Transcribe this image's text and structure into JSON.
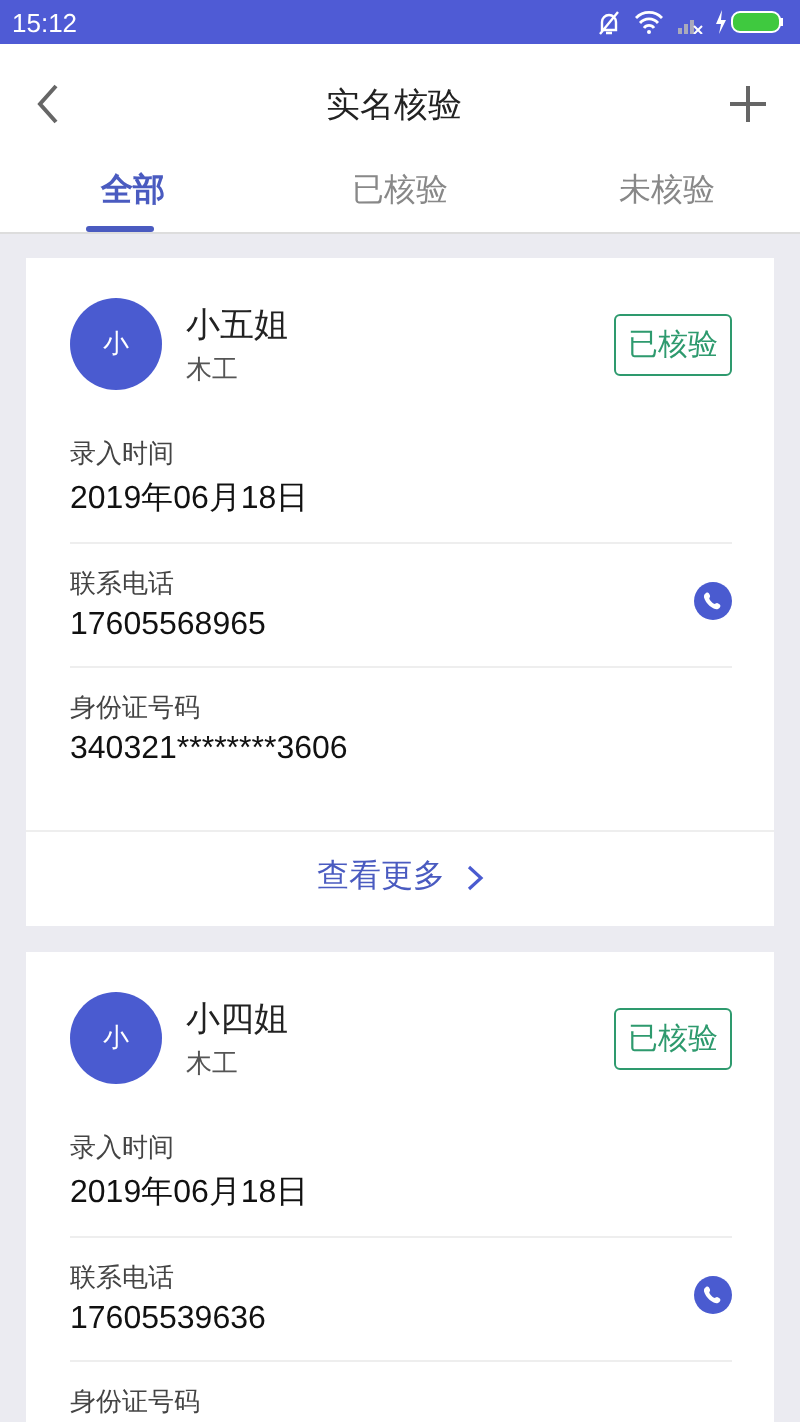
{
  "status_bar": {
    "time": "15:12"
  },
  "header": {
    "title": "实名核验"
  },
  "tabs": [
    {
      "label": "全部",
      "selected": true
    },
    {
      "label": "已核验",
      "selected": false
    },
    {
      "label": "未核验",
      "selected": false
    }
  ],
  "cards": [
    {
      "avatar": "小",
      "name": "小五姐",
      "role": "木工",
      "status": "已核验",
      "verified": true,
      "fields": [
        {
          "kind": "text",
          "label": "录入时间",
          "value": "2019年06月18日"
        },
        {
          "kind": "phone",
          "label": "联系电话",
          "value": "17605568965"
        },
        {
          "kind": "text",
          "label": "身份证号码",
          "value": "340321********3606"
        }
      ],
      "more": "查看更多"
    },
    {
      "avatar": "小",
      "name": "小四姐",
      "role": "木工",
      "status": "已核验",
      "verified": true,
      "fields": [
        {
          "kind": "text",
          "label": "录入时间",
          "value": "2019年06月18日"
        },
        {
          "kind": "phone",
          "label": "联系电话",
          "value": "17605539636"
        },
        {
          "kind": "text",
          "label": "身份证号码"
        }
      ]
    }
  ]
}
